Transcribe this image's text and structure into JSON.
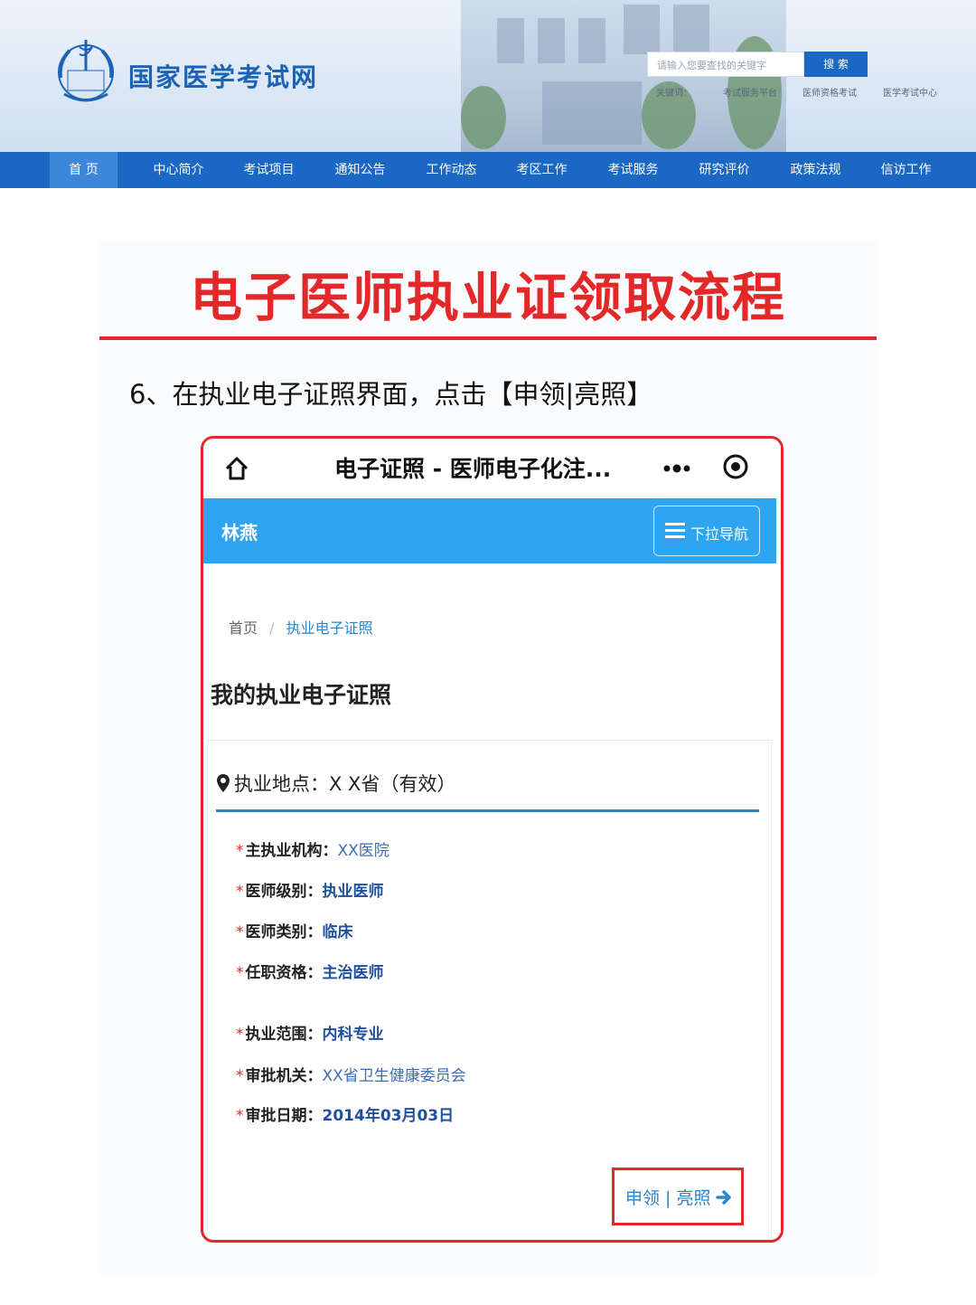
{
  "header": {
    "site_name": "国家医学考试网",
    "search_placeholder": "请输入您要查找的关键字",
    "search_button": "搜 索",
    "keywords_label": "关键词：",
    "keywords": [
      "考试服务平台",
      "医师资格考试",
      "医学考试中心"
    ]
  },
  "nav": {
    "items": [
      "首 页",
      "中心简介",
      "考试项目",
      "通知公告",
      "工作动态",
      "考区工作",
      "考试服务",
      "研究评价",
      "政策法规",
      "信访工作"
    ],
    "active_index": 0
  },
  "content": {
    "title": "电子医师执业证领取流程",
    "step_text": "6、在执业电子证照界面，点击【申领|亮照】"
  },
  "phone": {
    "top_title": "电子证照 - 医师电子化注...",
    "user_name": "林燕",
    "dropdown_label": "下拉导航",
    "breadcrumb_home": "首页",
    "breadcrumb_sep": "/",
    "breadcrumb_current": "执业电子证照",
    "section_title": "我的执业电子证照",
    "location_label": "执业地点：",
    "location_value": "X X省（有效）",
    "star": "*",
    "fields": [
      {
        "label": "主执业机构：",
        "value": "XX医院"
      },
      {
        "label": "医师级别：",
        "value": "执业医师"
      },
      {
        "label": "医师类别：",
        "value": "临床"
      },
      {
        "label": "任职资格：",
        "value": "主治医师"
      },
      {
        "label": "执业范围：",
        "value": "内科专业"
      },
      {
        "label": "审批机关：",
        "value": "XX省卫生健康委员会"
      },
      {
        "label": "审批日期：",
        "value": "2014年03月03日"
      }
    ],
    "apply_button": "申领 | 亮照"
  },
  "colors": {
    "nav_blue": "#1a67c4",
    "accent_red": "#e3282a",
    "bar_blue": "#2fa4f0",
    "link_blue": "#2a86c9"
  }
}
